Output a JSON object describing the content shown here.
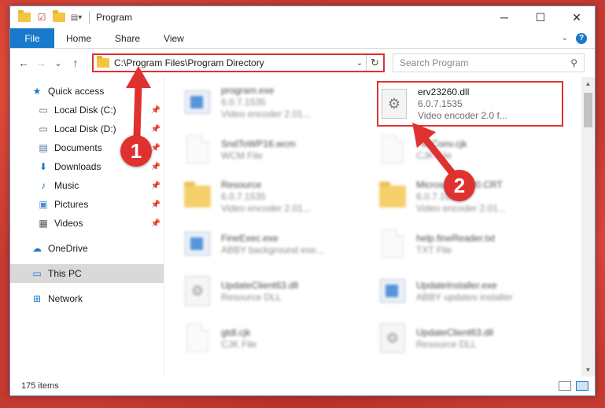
{
  "window": {
    "title": "Program",
    "controls": {
      "minimize": "─",
      "maximize": "☐",
      "close": "✕"
    }
  },
  "ribbon": {
    "file": "File",
    "tabs": [
      "Home",
      "Share",
      "View"
    ]
  },
  "nav": {
    "back": "←",
    "forward": "→",
    "recent": "⌄",
    "up": "↑",
    "address_path": "C:\\Program Files\\Program Directory",
    "refresh": "↻",
    "search_placeholder": "Search Program"
  },
  "sidebar": {
    "items": [
      {
        "label": "Quick access",
        "icon": "star-icon",
        "pinned": false
      },
      {
        "label": "Local Disk (C:)",
        "icon": "drive-icon",
        "pinned": true
      },
      {
        "label": "Local Disk (D:)",
        "icon": "drive-icon",
        "pinned": true
      },
      {
        "label": "Documents",
        "icon": "documents-icon",
        "pinned": true
      },
      {
        "label": "Downloads",
        "icon": "download-icon",
        "pinned": true
      },
      {
        "label": "Music",
        "icon": "music-icon",
        "pinned": true
      },
      {
        "label": "Pictures",
        "icon": "pictures-icon",
        "pinned": true
      },
      {
        "label": "Videos",
        "icon": "videos-icon",
        "pinned": true
      },
      {
        "label": "OneDrive",
        "icon": "cloud-icon",
        "pinned": false
      },
      {
        "label": "This PC",
        "icon": "computer-icon",
        "pinned": false
      },
      {
        "label": "Network",
        "icon": "network-icon",
        "pinned": false
      }
    ]
  },
  "files": [
    {
      "name": "program.exe",
      "line2": "6.0.7.1535",
      "line3": "Video encoder 2.01...",
      "icon": "app-icon"
    },
    {
      "name": "erv23260.dll",
      "line2": "6.0.7.1535",
      "line3": "Video encoder 2.0 f...",
      "icon": "dll-gear-icon"
    },
    {
      "name": "SndToWP16.wcm",
      "line2": "WCM File",
      "line3": "",
      "icon": "document-icon"
    },
    {
      "name": "FileConv.cjk",
      "line2": "CJK File",
      "line3": "",
      "icon": "document-icon"
    },
    {
      "name": "Resource",
      "line2": "6.0.7.1535",
      "line3": "Video encoder 2.01...",
      "icon": "folder-icon"
    },
    {
      "name": "Microsoft.VC90.CRT",
      "line2": "6.0.7.1535",
      "line3": "Video encoder 2.01...",
      "icon": "folder-icon"
    },
    {
      "name": "FineExec.exe",
      "line2": "ABBY background exe...",
      "line3": "",
      "icon": "app-icon"
    },
    {
      "name": "help.fineReader.txt",
      "line2": "TXT File",
      "line3": "",
      "icon": "document-icon"
    },
    {
      "name": "UpdateClient63.dll",
      "line2": "Resource DLL",
      "line3": "",
      "icon": "dll-gear-icon"
    },
    {
      "name": "UpdateInstaller.exe",
      "line2": "ABBY updates installer",
      "line3": "",
      "icon": "app-icon"
    },
    {
      "name": "gtdl.cjk",
      "line2": "CJK File",
      "line3": "",
      "icon": "document-icon"
    },
    {
      "name": "UpdateClient63.dll",
      "line2": "Resource DLL",
      "line3": "",
      "icon": "dll-gear-icon"
    }
  ],
  "status": {
    "item_count": "175 items"
  },
  "annotations": {
    "step1": "1",
    "step2": "2",
    "accent": "#e03131"
  }
}
